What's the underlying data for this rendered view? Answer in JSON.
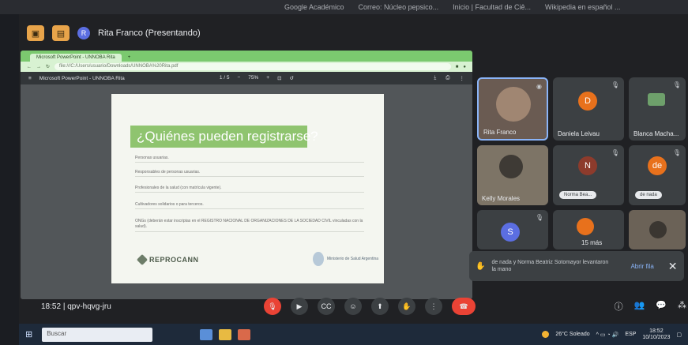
{
  "bookmarks": [
    "Google Académico",
    "Correo: Núcleo pepsico...",
    "Inicio | Facultad de Ciê...",
    "Wikipedia en español ..."
  ],
  "presenter": {
    "initial": "R",
    "label": "Rita Franco (Presentando)"
  },
  "browser": {
    "tab": "Microsoft PowerPoint - UNNOBA Rita",
    "address": "file:///C:/Users/usuario/Downloads/UNNOBA%20Rita.pdf",
    "pdf_title": "Microsoft PowerPoint - UNNOBA Rita",
    "page": "1 / 5",
    "zoom": "75%"
  },
  "slide": {
    "title": "¿Quiénes pueden registrarse?",
    "lines": [
      "Personas usuarias.",
      "Responsables de personas usuarias.",
      "Profesionales de la salud (con matrícula vigente).",
      "Cultivadores solidarios o para terceros.",
      "ONGs (deberán estar inscriptas en el REGISTRO NACIONAL DE ORGANIZACIONES DE LA SOCIEDAD CIVIL vinculadas con la salud)."
    ],
    "logo": "REPROCANN",
    "ministry": "Ministerio de Salud Argentina"
  },
  "participants": [
    {
      "name": "Rita Franco"
    },
    {
      "name": "Daniela Leivau",
      "initial": "D",
      "color": "#e8711c"
    },
    {
      "name": "Blanca Macha..."
    },
    {
      "name": "Kelly Morales"
    },
    {
      "name": "",
      "initial": "N",
      "color": "#8d3b2c",
      "pill": "Norma Bea..."
    },
    {
      "name": "",
      "initial": "de",
      "color": "#e8711c",
      "pill": "de nada"
    },
    {
      "name": "",
      "initial": "S",
      "color": "#5b6ee1"
    },
    {
      "name": "",
      "more": "15 más"
    },
    {
      "name": ""
    }
  ],
  "toast": {
    "message": "de nada y Norma Beatriz Sotomayor levantaron la mano",
    "open": "Abrir fila"
  },
  "meeting": {
    "time": "18:52",
    "code": "qpv-hqvg-jru"
  },
  "taskbar": {
    "search": "Buscar",
    "weather": "26°C Soleado",
    "lang": "ESP",
    "clock_time": "18:52",
    "clock_date": "10/10/2023"
  }
}
